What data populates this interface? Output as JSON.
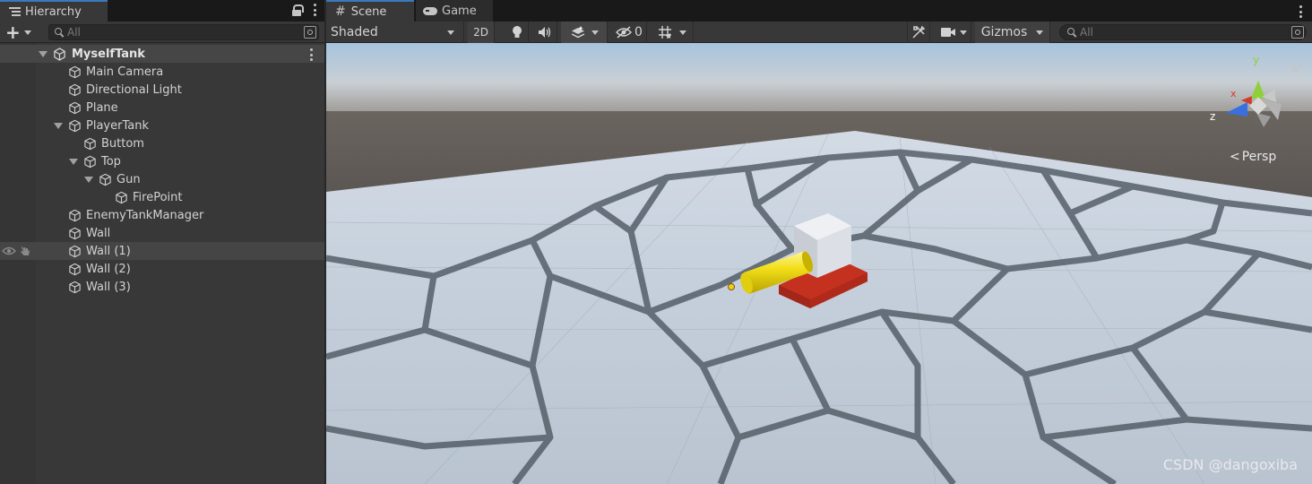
{
  "hierarchy": {
    "tab_label": "Hierarchy",
    "search_placeholder": "All",
    "scene_name": "MyselfTank",
    "items": [
      {
        "label": "Main Camera"
      },
      {
        "label": "Directional Light"
      },
      {
        "label": "Plane"
      },
      {
        "label": "PlayerTank"
      },
      {
        "label": "Buttom"
      },
      {
        "label": "Top"
      },
      {
        "label": "Gun"
      },
      {
        "label": "FirePoint"
      },
      {
        "label": "EnemyTankManager"
      },
      {
        "label": "Wall"
      },
      {
        "label": "Wall (1)"
      },
      {
        "label": "Wall (2)"
      },
      {
        "label": "Wall (3)"
      }
    ]
  },
  "scene_view": {
    "tabs": [
      {
        "label": "Scene",
        "icon": "hash-icon",
        "active": true
      },
      {
        "label": "Game",
        "icon": "gamepad-icon",
        "active": false
      }
    ],
    "shading_mode": "Shaded",
    "mode_2d_label": "2D",
    "hidden_count": "0",
    "gizmos_label": "Gizmos",
    "search_placeholder": "All",
    "projection_label": "Persp",
    "axis_labels": {
      "x": "x",
      "y": "y",
      "z": "z"
    },
    "watermark": "CSDN @dangoxiba"
  },
  "colors": {
    "accent": "#3a79bb",
    "panel_bg": "#383838",
    "sky_top": "#a9c6e0",
    "ground": "#5e5956",
    "tank_top": "#dcdfe6",
    "tank_base": "#c4321f",
    "gun": "#f4e21c",
    "axis_x": "#d43a2a",
    "axis_y": "#8fcf3a",
    "axis_z": "#3a6fe0"
  }
}
